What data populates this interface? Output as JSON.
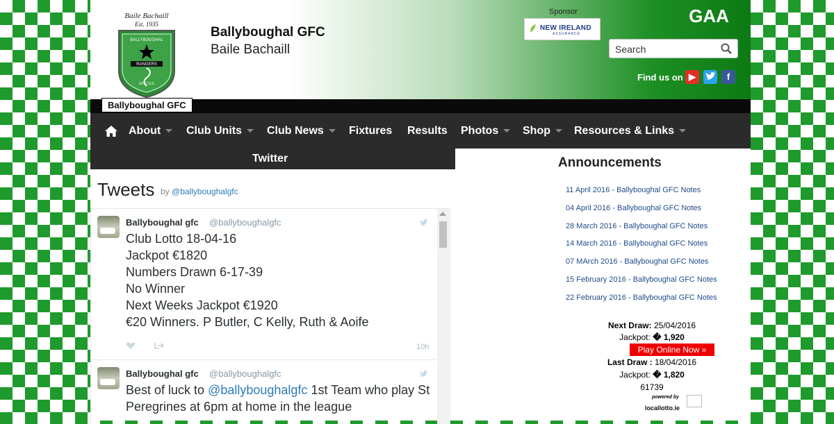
{
  "header": {
    "crest_top_text": "Baile Bachaill",
    "crest_est": "Est. 1935",
    "crest_tag": "Ballyboughal GFC",
    "site_title": "Ballyboughal GFC",
    "site_subtitle": "Baile Bachaill",
    "sponsor_label": "Sponsor",
    "sponsor_name": "NEW IRELAND",
    "sponsor_sub": "ASSURANCE",
    "gaa_logo": "GAA",
    "search_placeholder": "Search",
    "find_us": "Find us on"
  },
  "nav": {
    "items": [
      {
        "label": "About",
        "dropdown": true
      },
      {
        "label": "Club Units",
        "dropdown": true
      },
      {
        "label": "Club News",
        "dropdown": true
      },
      {
        "label": "Fixtures",
        "dropdown": false
      },
      {
        "label": "Results",
        "dropdown": false
      },
      {
        "label": "Photos",
        "dropdown": true
      },
      {
        "label": "Shop",
        "dropdown": true
      },
      {
        "label": "Resources & Links",
        "dropdown": true
      }
    ],
    "row2": "Twitter"
  },
  "tweets": {
    "title": "Tweets",
    "by_prefix": "by",
    "by_handle": "@ballyboughalgfc",
    "items": [
      {
        "name": "Ballyboughal gfc",
        "handle": "@ballyboughalgfc",
        "lines": [
          "Club Lotto 18-04-16",
          "Jackpot €1820",
          "Numbers Drawn  6-17-39",
          "No Winner",
          "Next Weeks Jackpot  €1920",
          "€20 Winners. P Butler, C Kelly,  Ruth & Aoife"
        ],
        "time": "10h"
      },
      {
        "name": "Ballyboughal gfc",
        "handle": "@ballyboughalgfc",
        "text_before": "Best of luck to ",
        "mention": "@ballyboughalgfc",
        "text_after": " 1st Team who play St Peregrines at 6pm at home in the league"
      }
    ]
  },
  "announcements": {
    "title": "Announcements",
    "items": [
      "11 April 2016 - Ballyboughal GFC Notes",
      "04 April 2016 - Ballyboughal GFC Notes",
      "28 March 2016 - Ballyboughal GFC Notes",
      "14 March 2016 - Ballyboughal GFC Notes",
      "07 MArch 2016 - Ballyboughal GFC Notes",
      "15 February 2016 - Ballyboughal GFC Notes",
      "22 February 2016 - Ballyboughal GFC Notes"
    ]
  },
  "lotto": {
    "next_draw_label": "Next Draw:",
    "next_draw_date": "25/04/2016",
    "jackpot_label": "Jackpot:",
    "jackpot_next": "� 1,920",
    "play_button": "Play Online Now »",
    "last_draw_label": "Last Draw :",
    "last_draw_date": "18/04/2016",
    "jackpot_last": "� 1,820",
    "numbers": "61739",
    "powered_by": "powered by",
    "provider": "locallotto.ie"
  },
  "colors": {
    "brand_green": "#1f9a2c",
    "nav_bg": "#2b2b2b",
    "link_blue": "#1f4a8a",
    "play_red": "#ee0000"
  }
}
